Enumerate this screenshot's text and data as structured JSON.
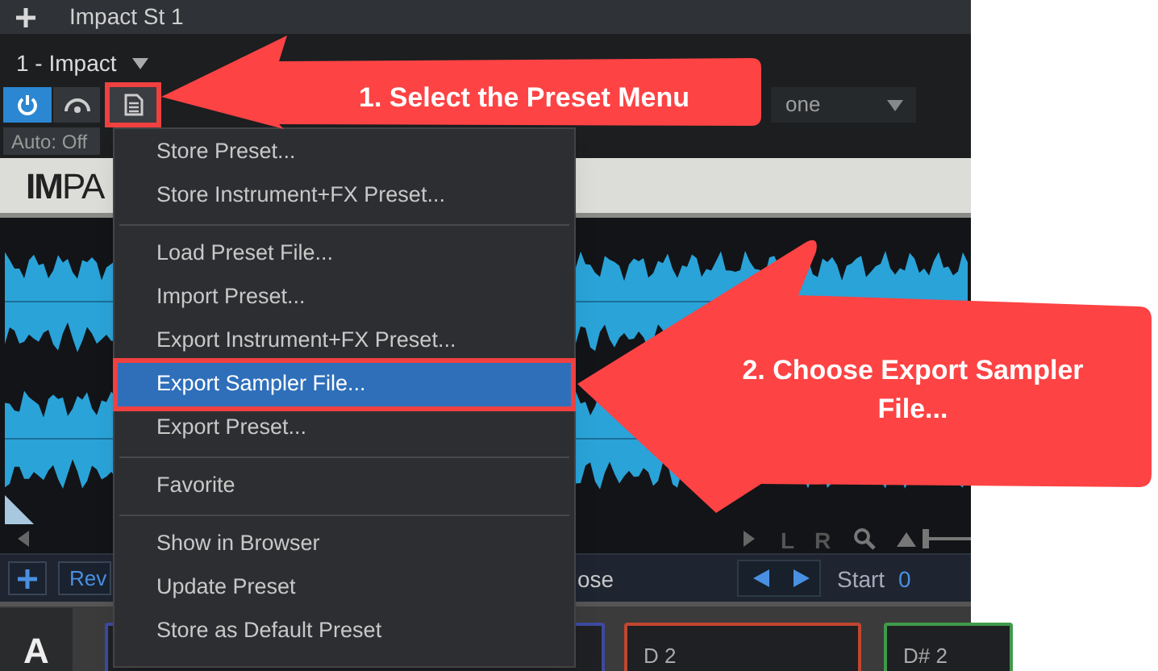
{
  "tab_bar": {
    "title": "Impact St 1"
  },
  "instrument": {
    "name": "1 - Impact"
  },
  "toolbar": {
    "power_on": true,
    "preset_button_highlighted": true,
    "automation": "Auto: Off",
    "preset_dropdown": "one"
  },
  "logo": "**IM**PA",
  "menu": [
    {
      "kind": "item",
      "label": "Store Preset...",
      "selected": false
    },
    {
      "kind": "item",
      "label": "Store Instrument+FX Preset...",
      "selected": false
    },
    {
      "kind": "divider"
    },
    {
      "kind": "item",
      "label": "Load Preset File...",
      "selected": false
    },
    {
      "kind": "item",
      "label": "Import Preset...",
      "selected": false
    },
    {
      "kind": "item",
      "label": "Export Instrument+FX Preset...",
      "selected": false
    },
    {
      "kind": "item",
      "label": "Export Sampler File...",
      "selected": true,
      "highlighted": true
    },
    {
      "kind": "item",
      "label": "Export Preset...",
      "selected": false
    },
    {
      "kind": "divider"
    },
    {
      "kind": "item",
      "label": "Favorite",
      "selected": false
    },
    {
      "kind": "divider"
    },
    {
      "kind": "item",
      "label": "Show in Browser",
      "selected": false
    },
    {
      "kind": "item",
      "label": "Update Preset",
      "selected": false
    },
    {
      "kind": "item",
      "label": "Store as Default Preset",
      "selected": false
    }
  ],
  "waveform_toolbar": {
    "left_channel": "L",
    "right_channel": "R",
    "zoom": {
      "level": 0
    }
  },
  "sample_bar": {
    "button": "Rev",
    "text": "ose",
    "start_label": "Start",
    "start_value": "0"
  },
  "pad_bank": "A",
  "pads": [
    {
      "color": "#3d4aa0"
    },
    {
      "label": "D 2",
      "color": "#c0462f"
    },
    {
      "label": "D# 2",
      "color": "#3f9a4a"
    }
  ],
  "annotations": [
    {
      "text": "1. Select the Preset Menu"
    },
    {
      "text": "2. Choose Export Sampler File..."
    }
  ]
}
